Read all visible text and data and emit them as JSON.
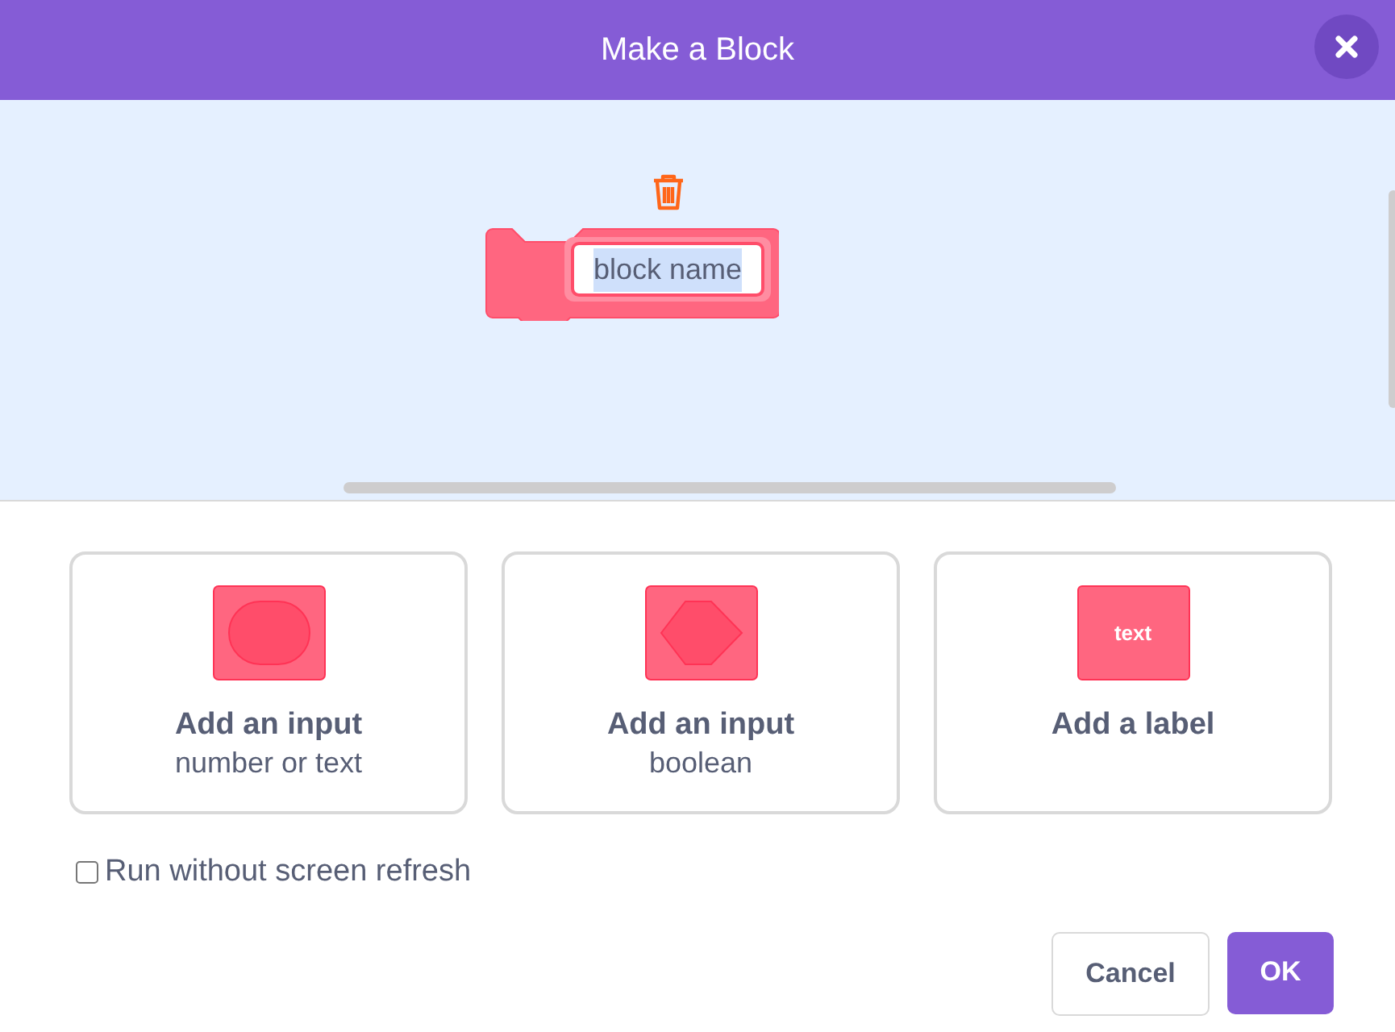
{
  "window": {
    "title": "Make a Block"
  },
  "block": {
    "name_field": {
      "value": "block name",
      "selected": true
    }
  },
  "options": [
    {
      "kind": "round",
      "title": "Add an input",
      "subtitle": "number or text"
    },
    {
      "kind": "hexagon",
      "title": "Add an input",
      "subtitle": "boolean"
    },
    {
      "kind": "label",
      "icon_text": "text",
      "title": "Add a label"
    }
  ],
  "run_without_refresh": {
    "label": "Run without screen refresh",
    "checked": false
  },
  "buttons": [
    {
      "label": "Cancel",
      "kind": "secondary"
    },
    {
      "label": "OK",
      "kind": "primary"
    }
  ]
}
